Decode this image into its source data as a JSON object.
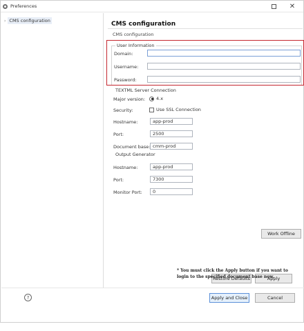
{
  "window": {
    "title": "Preferences",
    "maximize_icon": "maximize-icon",
    "close_glyph": "✕"
  },
  "sidebar": {
    "items": [
      {
        "label": "CMS configuration",
        "expanded": false
      }
    ]
  },
  "page": {
    "title": "CMS configuration",
    "subtitle": "CMS configuration"
  },
  "user_info": {
    "legend": "User Information",
    "domain_label": "Domain:",
    "domain_value": "",
    "username_label": "Username:",
    "username_value": "",
    "password_label": "Password:",
    "password_value": ""
  },
  "server": {
    "legend": "TEXTML Server Connection",
    "major_version_label": "Major version:",
    "major_version_value": "4.x",
    "security_label": "Security:",
    "ssl_label": "Use SSL Connection",
    "ssl_checked": false,
    "hostname_label": "Hostname:",
    "hostname_value": "app-prod",
    "port_label": "Port:",
    "port_value": "2500",
    "docbase_label": "Document base:",
    "docbase_value": "cmm-prod"
  },
  "output": {
    "legend": "Output Generator",
    "hostname_label": "Hostname:",
    "hostname_value": "app-prod",
    "port_label": "Port:",
    "port_value": "7300",
    "monitor_label": "Monitor Port:",
    "monitor_value": "0"
  },
  "buttons": {
    "work_offline": "Work Offline",
    "restore_defaults": "Restore Defaults",
    "apply": "Apply",
    "apply_close": "Apply and Close",
    "cancel": "Cancel"
  },
  "note": "* You must click the Apply button if you want to login to the specified document base now.",
  "colors": {
    "highlight_border": "#c4262e",
    "primary_button_border": "#5a8fd8"
  }
}
